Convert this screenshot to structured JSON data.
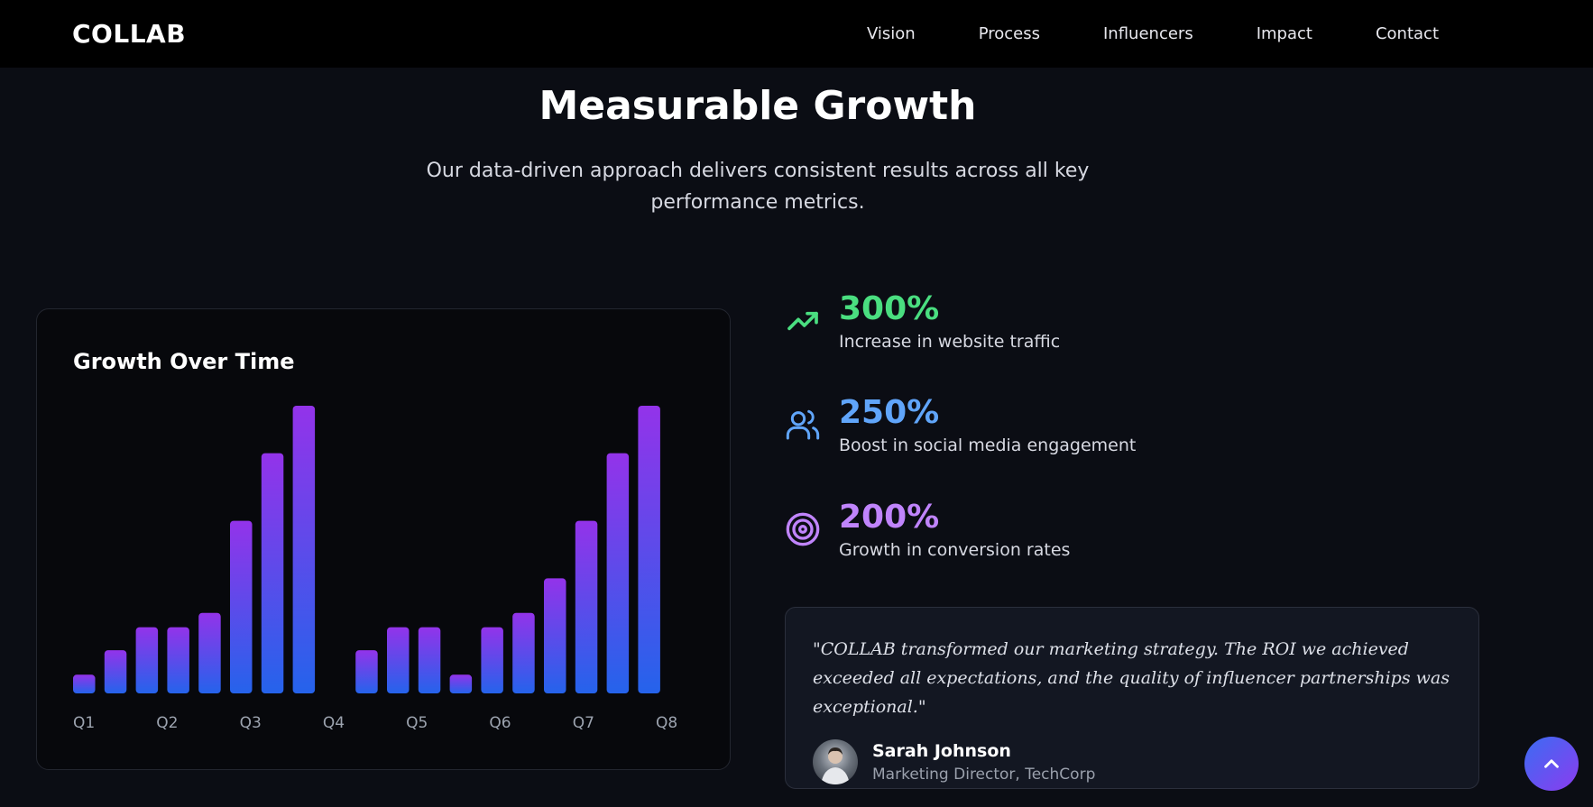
{
  "nav": {
    "logo": "COLLAB",
    "links": [
      "Vision",
      "Process",
      "Influencers",
      "Impact",
      "Contact"
    ]
  },
  "section": {
    "title": "Measurable Growth",
    "subtitle": "Our data-driven approach delivers consistent results across all key performance metrics."
  },
  "chart_data": {
    "type": "bar",
    "title": "Growth Over Time",
    "categories": [
      "Q1",
      "Q2",
      "Q3",
      "Q4",
      "Q5",
      "Q6",
      "Q7",
      "Q8"
    ],
    "values": [
      6.5,
      15,
      23,
      23,
      28,
      60,
      83.5,
      100,
      0,
      15,
      23,
      23,
      6.5,
      23,
      28,
      40,
      60,
      83.5,
      100
    ],
    "ylim": [
      0,
      100
    ],
    "colors": {
      "bar_top": "#9333ea",
      "bar_bottom": "#2563eb"
    }
  },
  "stats": [
    {
      "value": "300%",
      "label": "Increase in website traffic",
      "icon": "trending-up-icon",
      "color": "#4ade80"
    },
    {
      "value": "250%",
      "label": "Boost in social media engagement",
      "icon": "users-icon",
      "color": "#60a5fa"
    },
    {
      "value": "200%",
      "label": "Growth in conversion rates",
      "icon": "target-icon",
      "color": "#c084fc"
    }
  ],
  "testimonial": {
    "quote": "\"COLLAB transformed our marketing strategy. The ROI we achieved exceeded all expectations, and the quality of influencer partnerships was exceptional.\"",
    "name": "Sarah Johnson",
    "role": "Marketing Director, TechCorp"
  }
}
